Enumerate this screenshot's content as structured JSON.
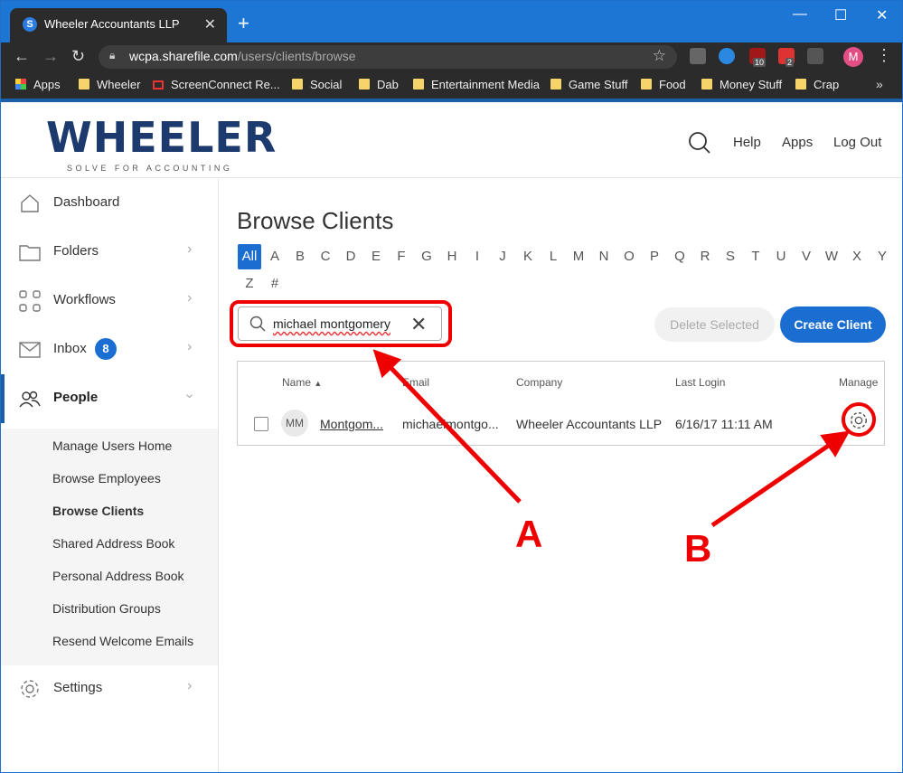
{
  "browser": {
    "tab_title": "Wheeler Accountants LLP",
    "favicon_letter": "S",
    "url_host": "wcpa.sharefile.com",
    "url_path": "/users/clients/browse",
    "profile_initial": "M",
    "ext_badge_1": "10",
    "ext_badge_2": "2",
    "bookmarks": [
      "Apps",
      "Wheeler",
      "ScreenConnect Re...",
      "Social",
      "Dab",
      "Entertainment Media",
      "Game Stuff",
      "Food",
      "Money Stuff",
      "Crap"
    ]
  },
  "header": {
    "logo": "WHEELER",
    "tagline": "SOLVE FOR ACCOUNTING",
    "help": "Help",
    "apps": "Apps",
    "logout": "Log Out"
  },
  "sidebar": {
    "dashboard": "Dashboard",
    "folders": "Folders",
    "workflows": "Workflows",
    "inbox": "Inbox",
    "inbox_count": "8",
    "people": "People",
    "settings": "Settings",
    "people_sub": [
      "Manage Users Home",
      "Browse Employees",
      "Browse Clients",
      "Shared Address Book",
      "Personal Address Book",
      "Distribution Groups",
      "Resend Welcome Emails"
    ]
  },
  "main": {
    "title": "Browse Clients",
    "alphabet": [
      "All",
      "A",
      "B",
      "C",
      "D",
      "E",
      "F",
      "G",
      "H",
      "I",
      "J",
      "K",
      "L",
      "M",
      "N",
      "O",
      "P",
      "Q",
      "R",
      "S",
      "T",
      "U",
      "V",
      "W",
      "X",
      "Y",
      "Z",
      "#"
    ],
    "search_value": "michael montgomery",
    "delete_selected": "Delete Selected",
    "create_client": "Create Client",
    "columns": {
      "name": "Name",
      "email": "Email",
      "company": "Company",
      "last_login": "Last Login",
      "manage": "Manage"
    },
    "row": {
      "initials": "MM",
      "name": "Montgom...",
      "email": "michaelmontgo...",
      "company": "Wheeler Accountants LLP",
      "last_login": "6/16/17 11:11 AM"
    }
  },
  "annotations": {
    "a": "A",
    "b": "B"
  },
  "colors": {
    "accent": "#1b6ed1",
    "annotation": "#e00000",
    "chrome_tab": "#1e76d4"
  }
}
